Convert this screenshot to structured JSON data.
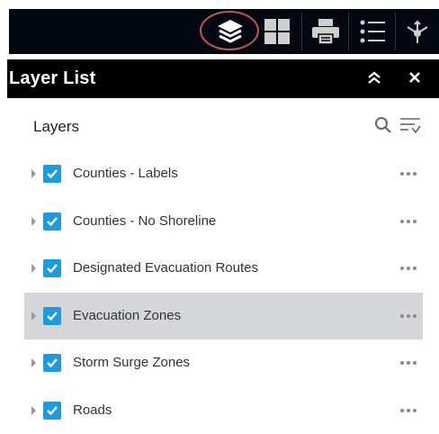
{
  "toolbar": {
    "tools": [
      {
        "icon": "layers-icon"
      },
      {
        "icon": "basemap-gallery-icon"
      },
      {
        "icon": "print-icon"
      },
      {
        "icon": "legend-icon"
      },
      {
        "icon": "share-icon"
      }
    ]
  },
  "panel": {
    "title": "Layer List",
    "collapse_icon": "double-chevron-up-icon",
    "close_icon": "close-icon"
  },
  "layers_section": {
    "label": "Layers",
    "search_icon": "search-icon",
    "filter_icon": "filter-list-icon"
  },
  "layers": [
    {
      "name": "Counties - Labels",
      "checked": true,
      "selected": false
    },
    {
      "name": "Counties - No Shoreline",
      "checked": true,
      "selected": false
    },
    {
      "name": "Designated Evacuation Routes",
      "checked": true,
      "selected": false
    },
    {
      "name": "Evacuation Zones",
      "checked": true,
      "selected": true
    },
    {
      "name": "Storm Surge Zones",
      "checked": true,
      "selected": false
    },
    {
      "name": "Roads",
      "checked": true,
      "selected": false
    }
  ],
  "colors": {
    "toolbar_bg": "#030712",
    "header_bg": "#000000",
    "checkbox": "#1e9bdc",
    "selected_row": "#d4d6d9",
    "highlight_ring": "#c0584f"
  }
}
